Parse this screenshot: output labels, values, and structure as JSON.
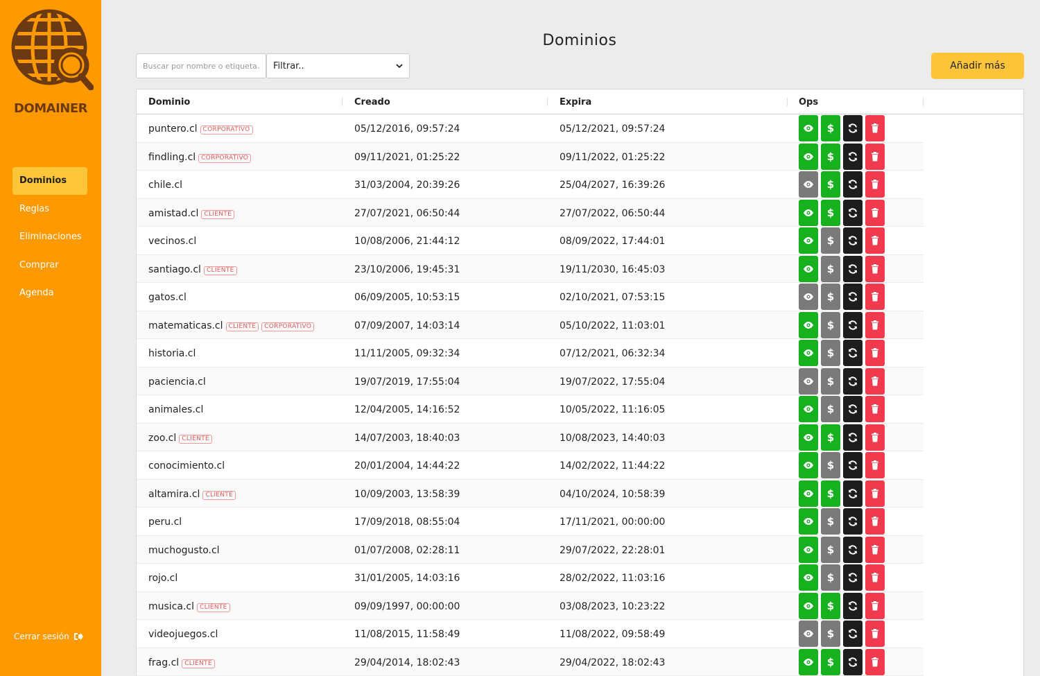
{
  "brand": "DOMAINER",
  "nav": [
    {
      "label": "Dominios",
      "active": true
    },
    {
      "label": "Reglas",
      "active": false
    },
    {
      "label": "Eliminaciones",
      "active": false
    },
    {
      "label": "Comprar",
      "active": false
    },
    {
      "label": "Agenda",
      "active": false
    }
  ],
  "logout_label": "Cerrar sesión",
  "page_title": "Dominios",
  "search": {
    "placeholder": "Buscar por nombre o etiqueta.."
  },
  "filter": {
    "selected": "Filtrar.."
  },
  "add_button": "Añadir más",
  "colors": {
    "sidebar": "#ff9900",
    "accent": "#ffc53a",
    "ok": "#17b11f",
    "off": "#7a7a7a",
    "renew": "#1d1d1d",
    "delete": "#f23a4f",
    "tag": "#e05a5a"
  },
  "table": {
    "columns": [
      "Dominio",
      "Creado",
      "Expira",
      "Ops"
    ],
    "rows": [
      {
        "domain": "puntero.cl",
        "tags": [
          "CORPORATIVO"
        ],
        "created": "05/12/2016, 09:57:24",
        "expires": "05/12/2021, 09:57:24",
        "view": true,
        "pay": true
      },
      {
        "domain": "findling.cl",
        "tags": [
          "CORPORATIVO"
        ],
        "created": "09/11/2021, 01:25:22",
        "expires": "09/11/2022, 01:25:22",
        "view": true,
        "pay": true
      },
      {
        "domain": "chile.cl",
        "tags": [],
        "created": "31/03/2004, 20:39:26",
        "expires": "25/04/2027, 16:39:26",
        "view": false,
        "pay": true
      },
      {
        "domain": "amistad.cl",
        "tags": [
          "CLIENTE"
        ],
        "created": "27/07/2021, 06:50:44",
        "expires": "27/07/2022, 06:50:44",
        "view": true,
        "pay": true
      },
      {
        "domain": "vecinos.cl",
        "tags": [],
        "created": "10/08/2006, 21:44:12",
        "expires": "08/09/2022, 17:44:01",
        "view": true,
        "pay": false
      },
      {
        "domain": "santiago.cl",
        "tags": [
          "CLIENTE"
        ],
        "created": "23/10/2006, 19:45:31",
        "expires": "19/11/2030, 16:45:03",
        "view": true,
        "pay": false
      },
      {
        "domain": "gatos.cl",
        "tags": [],
        "created": "06/09/2005, 10:53:15",
        "expires": "02/10/2021, 07:53:15",
        "view": false,
        "pay": false
      },
      {
        "domain": "matematicas.cl",
        "tags": [
          "CLIENTE",
          "CORPORATIVO"
        ],
        "created": "07/09/2007, 14:03:14",
        "expires": "05/10/2022, 11:03:01",
        "view": true,
        "pay": false
      },
      {
        "domain": "historia.cl",
        "tags": [],
        "created": "11/11/2005, 09:32:34",
        "expires": "07/12/2021, 06:32:34",
        "view": true,
        "pay": false
      },
      {
        "domain": "paciencia.cl",
        "tags": [],
        "created": "19/07/2019, 17:55:04",
        "expires": "19/07/2022, 17:55:04",
        "view": false,
        "pay": false
      },
      {
        "domain": "animales.cl",
        "tags": [],
        "created": "12/04/2005, 14:16:52",
        "expires": "10/05/2022, 11:16:05",
        "view": true,
        "pay": false
      },
      {
        "domain": "zoo.cl",
        "tags": [
          "CLIENTE"
        ],
        "created": "14/07/2003, 18:40:03",
        "expires": "10/08/2023, 14:40:03",
        "view": true,
        "pay": true
      },
      {
        "domain": "conocimiento.cl",
        "tags": [],
        "created": "20/01/2004, 14:44:22",
        "expires": "14/02/2022, 11:44:22",
        "view": true,
        "pay": false
      },
      {
        "domain": "altamira.cl",
        "tags": [
          "CLIENTE"
        ],
        "created": "10/09/2003, 13:58:39",
        "expires": "04/10/2024, 10:58:39",
        "view": true,
        "pay": true
      },
      {
        "domain": "peru.cl",
        "tags": [],
        "created": "17/09/2018, 08:55:04",
        "expires": "17/11/2021, 00:00:00",
        "view": true,
        "pay": false
      },
      {
        "domain": "muchogusto.cl",
        "tags": [],
        "created": "01/07/2008, 02:28:11",
        "expires": "29/07/2022, 22:28:01",
        "view": true,
        "pay": false
      },
      {
        "domain": "rojo.cl",
        "tags": [],
        "created": "31/01/2005, 14:03:16",
        "expires": "28/02/2022, 11:03:16",
        "view": true,
        "pay": false
      },
      {
        "domain": "musica.cl",
        "tags": [
          "CLIENTE"
        ],
        "created": "09/09/1997, 00:00:00",
        "expires": "03/08/2023, 10:23:22",
        "view": true,
        "pay": true
      },
      {
        "domain": "videojuegos.cl",
        "tags": [],
        "created": "11/08/2015, 11:58:49",
        "expires": "11/08/2022, 09:58:49",
        "view": false,
        "pay": false
      },
      {
        "domain": "frag.cl",
        "tags": [
          "CLIENTE"
        ],
        "created": "29/04/2014, 18:02:43",
        "expires": "29/04/2022, 18:02:43",
        "view": true,
        "pay": true
      }
    ]
  }
}
